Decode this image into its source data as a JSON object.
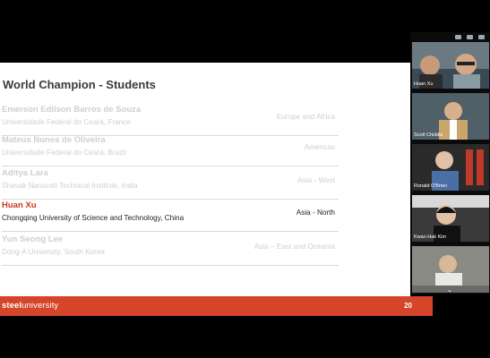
{
  "slide": {
    "title": "World Champion - Students",
    "entries": [
      {
        "name": "Emerson Edilson Barros de Souza",
        "university": "Universidade Federal do Ceará, France",
        "region": "Europe and Africa",
        "active": false
      },
      {
        "name": "Mateus Nunes de Oliveira",
        "university": "Universidade Federal do Ceará, Brazil",
        "region": "Americas",
        "active": false
      },
      {
        "name": "Aditya Lara",
        "university": "Shavak Nanavati Technical Institute, India",
        "region": "Asia - West",
        "active": false
      },
      {
        "name": "Huan Xu",
        "university": "Chongqing University of Science and Technology, China",
        "region": "Asia - North",
        "active": true
      },
      {
        "name": "Yun Seong Lee",
        "university": "Dong-A University, South Korea",
        "region": "Asia – East and Oceania",
        "active": false
      }
    ],
    "brand_bold": "steel",
    "brand_rest": "university",
    "page_number": "20"
  },
  "participants": [
    {
      "label": "Huan Xu",
      "color": "#3a4a55"
    },
    {
      "label": "Scott Chiddis",
      "color": "#4a5a62"
    },
    {
      "label": "Ronald O'Brien",
      "color": "#5a3a3a"
    },
    {
      "label": "Kwan Hak Kim",
      "color": "#2f2f2f"
    },
    {
      "label": "",
      "color": "#6a6a66"
    }
  ],
  "colors": {
    "accent": "#d5452a",
    "active_name": "#c8391f",
    "muted": "#cfcfcf"
  }
}
